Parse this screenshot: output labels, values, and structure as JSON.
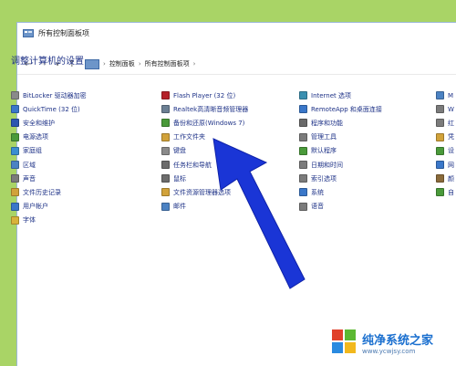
{
  "window": {
    "title": "所有控制面板项"
  },
  "breadcrumb": {
    "items": [
      "控制面板",
      "所有控制面板项"
    ]
  },
  "heading": "调整计算机的设置",
  "columns": [
    [
      {
        "label": "BitLocker 驱动器加密",
        "color": "#8a8a8a"
      },
      {
        "label": "QuickTime (32 位)",
        "color": "#3a77c9"
      },
      {
        "label": "安全和维护",
        "color": "#2a56b0"
      },
      {
        "label": "电源选项",
        "color": "#4a9a3a"
      },
      {
        "label": "家庭组",
        "color": "#3b8fd1"
      },
      {
        "label": "区域",
        "color": "#4b82c3"
      },
      {
        "label": "声音",
        "color": "#7b7b7b"
      },
      {
        "label": "文件历史记录",
        "color": "#d1a23a"
      },
      {
        "label": "用户帐户",
        "color": "#3a77c9"
      },
      {
        "label": "字体",
        "color": "#d8b23a"
      }
    ],
    [
      {
        "label": "Flash Player (32 位)",
        "color": "#b5222a"
      },
      {
        "label": "Realtek高清晰音频管理器",
        "color": "#6b7f93"
      },
      {
        "label": "备份和还原(Windows 7)",
        "color": "#4a9a3a"
      },
      {
        "label": "工作文件夹",
        "color": "#d1a23a"
      },
      {
        "label": "键盘",
        "color": "#8a8a8a"
      },
      {
        "label": "任务栏和导航",
        "color": "#6c6c6c"
      },
      {
        "label": "鼠标",
        "color": "#6c6c6c"
      },
      {
        "label": "文件资源管理器选项",
        "color": "#d1a23a"
      },
      {
        "label": "邮件",
        "color": "#4b82c3"
      }
    ],
    [
      {
        "label": "Internet 选项",
        "color": "#3a8fb0"
      },
      {
        "label": "RemoteApp 和桌面连接",
        "color": "#3a77c9"
      },
      {
        "label": "程序和功能",
        "color": "#6a6a6a"
      },
      {
        "label": "管理工具",
        "color": "#7b7b7b"
      },
      {
        "label": "默认程序",
        "color": "#4a9a3a"
      },
      {
        "label": "日期和时间",
        "color": "#7b7b7b"
      },
      {
        "label": "索引选项",
        "color": "#7b7b7b"
      },
      {
        "label": "系统",
        "color": "#3a77c9"
      },
      {
        "label": "语音",
        "color": "#7b7b7b"
      }
    ],
    [
      {
        "label": "M",
        "color": "#4b82c3"
      },
      {
        "label": "W",
        "color": "#7b7b7b"
      },
      {
        "label": "红",
        "color": "#7b7b7b"
      },
      {
        "label": "凭",
        "color": "#d1a23a"
      },
      {
        "label": "设",
        "color": "#4a9a3a"
      },
      {
        "label": "网",
        "color": "#3a77c9"
      },
      {
        "label": "颜",
        "color": "#8a6a3a"
      },
      {
        "label": "自",
        "color": "#4a9a3a"
      }
    ]
  ],
  "watermark": {
    "title": "纯净系统之家",
    "url": "www.ycwjsy.com"
  },
  "colors": {
    "link": "#1e3287",
    "arrow": "#1a35d6",
    "desktop": "#a9d466"
  }
}
